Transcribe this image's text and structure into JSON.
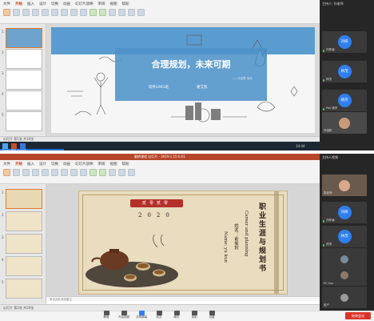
{
  "top": {
    "ribbon_tabs": [
      "文件",
      "开始",
      "插入",
      "设计",
      "切换",
      "动画",
      "幻灯片放映",
      "审阅",
      "视图",
      "帮助"
    ],
    "slide_title": "合理规划，未来可期",
    "slide_class": "软件1901班",
    "slide_author": "翟艾凯",
    "slide_quote": "——马克思·韦伯",
    "thumb_numbers": [
      "1",
      "2",
      "3",
      "4",
      "5",
      "6"
    ],
    "status_left": "幻灯片 第1张 共16张",
    "share_bar": "正在共享屏幕 停止共享",
    "clock": "14:44"
  },
  "top_meeting": {
    "title": "主持人: 孙老师",
    "participants": [
      {
        "initials": "刘梓",
        "name": "刘梓涵"
      },
      {
        "initials": "林茂",
        "name": "林茂"
      },
      {
        "initials": "姚宗",
        "name": "Pak 姚宗"
      },
      {
        "initials": "",
        "name": "毕绍彬"
      }
    ]
  },
  "bottom": {
    "window_title": "翻转课程 幻灯片 - 2019.1.15 6.01",
    "ribbon_tabs": [
      "文件",
      "开始",
      "插入",
      "设计",
      "切换",
      "动画",
      "幻灯片放映",
      "审阅",
      "视图",
      "帮助"
    ],
    "slide_badge_left": "贰零贰零",
    "slide_year": "2020",
    "slide_title_vertical": "职业生涯与规划书",
    "slide_subtitle_vertical": "Career and planning",
    "slide_name_label": "姓名：俞俊珩",
    "slide_name_en": "Name: yu kun",
    "thumb_numbers": [
      "1",
      "2",
      "3",
      "4",
      "5",
      "6"
    ],
    "status_left": "幻灯片 第2张 共26张",
    "notes_hint": "单击此处添加备注"
  },
  "bottom_meeting": {
    "title": "主持人视频",
    "participants": [
      {
        "initials": "",
        "name": "张老师"
      },
      {
        "initials": "刘梓",
        "name": "刘梓涵"
      },
      {
        "initials": "林茂",
        "name": "林茂"
      },
      {
        "initials": "",
        "name": "qlg"
      },
      {
        "initials": "",
        "name": "PC Sun"
      },
      {
        "initials": "",
        "name": "用户"
      }
    ]
  },
  "meeting_controls": [
    "静音",
    "开启视频",
    "共享屏幕",
    "成员",
    "聊天",
    "录制",
    "设置"
  ],
  "end_button": "结束会议",
  "colors": {
    "slide_blue_band": "#4f93c9",
    "thumb_selected": "#e07a2e",
    "avatar_blue": "#2f7ff0",
    "end_red": "#d9342b"
  }
}
